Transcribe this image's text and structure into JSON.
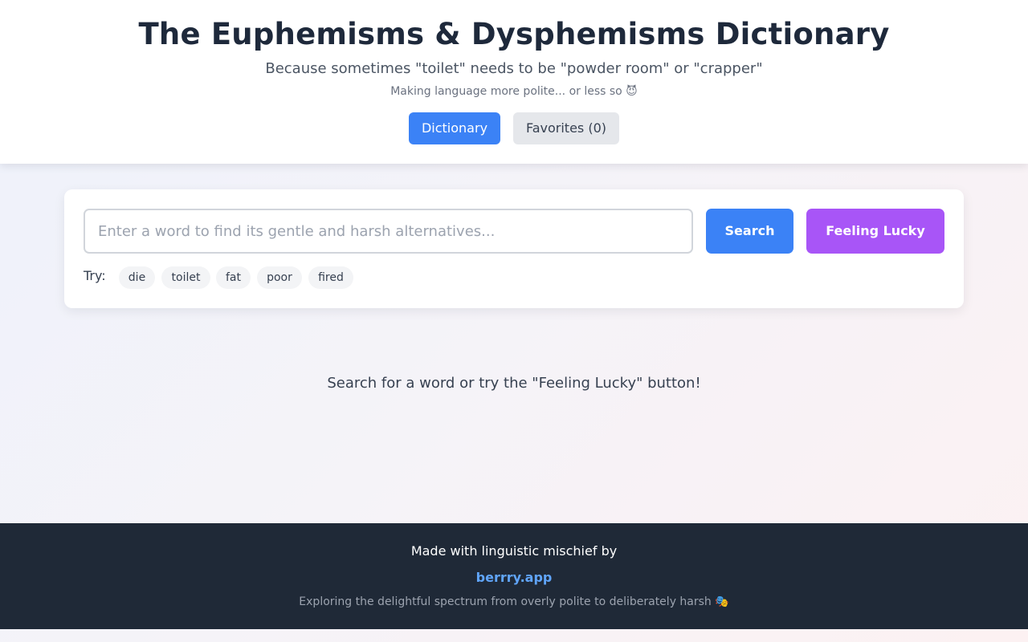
{
  "header": {
    "title": "The Euphemisms & Dysphemisms Dictionary",
    "subtitle": "Because sometimes \"toilet\" needs to be \"powder room\" or \"crapper\"",
    "tagline": "Making language more polite... or less so 😈",
    "nav": {
      "dictionary": "Dictionary",
      "favorites": "Favorites (0)"
    }
  },
  "search": {
    "placeholder": "Enter a word to find its gentle and harsh alternatives...",
    "value": "",
    "search_label": "Search",
    "lucky_label": "Feeling Lucky",
    "try_label": "Try:",
    "suggestions": [
      "die",
      "toilet",
      "fat",
      "poor",
      "fired"
    ]
  },
  "main": {
    "empty_message": "Search for a word or try the \"Feeling Lucky\" button!"
  },
  "footer": {
    "made_with": "Made with linguistic mischief by",
    "link_text": "berrry.app",
    "note": "Exploring the delightful spectrum from overly polite to deliberately harsh 🎭"
  },
  "colors": {
    "primary": "#3b82f6",
    "accent": "#a855f7",
    "footer_bg": "#1f2937",
    "link": "#60a5fa"
  }
}
